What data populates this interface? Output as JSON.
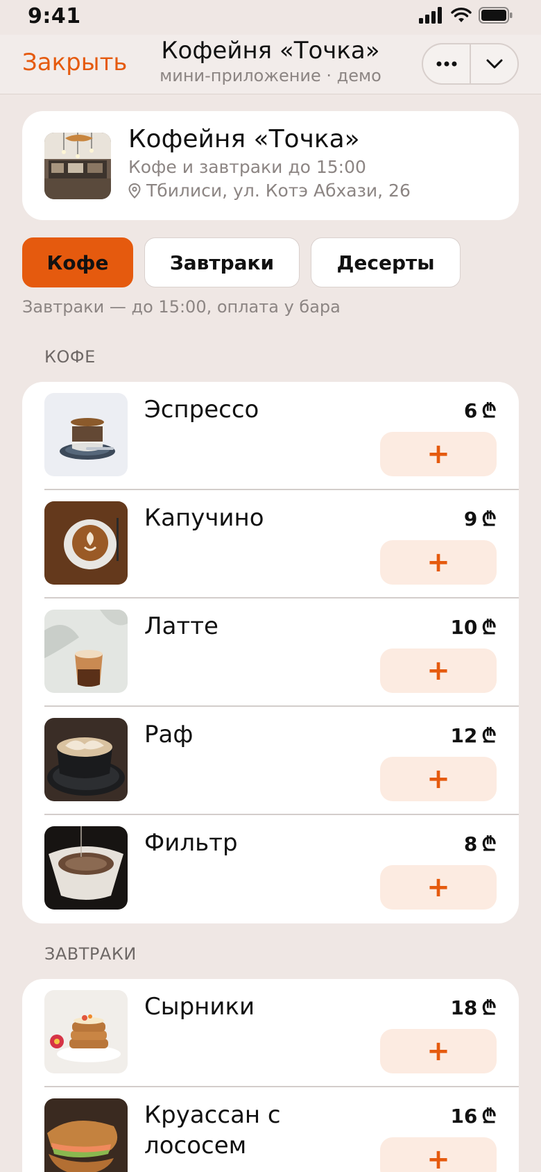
{
  "status_bar": {
    "time": "9:41"
  },
  "header": {
    "close_label": "Закрыть",
    "title": "Кофейня «Точка»",
    "subtitle": "мини-приложение · демо"
  },
  "shop": {
    "name": "Кофейня «Точка»",
    "description": "Кофе и завтраки до 15:00",
    "address": "Тбилиси, ул. Котэ Абхази, 26"
  },
  "tabs": [
    {
      "label": "Кофе",
      "active": true
    },
    {
      "label": "Завтраки",
      "active": false
    },
    {
      "label": "Десерты",
      "active": false
    }
  ],
  "hint": "Завтраки — до 15:00, оплата у бара",
  "currency_symbol": "₾",
  "sections": [
    {
      "title": "КОФЕ",
      "items": [
        {
          "name": "Эспрессо",
          "price": "6"
        },
        {
          "name": "Капучино",
          "price": "9"
        },
        {
          "name": "Латте",
          "price": "10"
        },
        {
          "name": "Раф",
          "price": "12"
        },
        {
          "name": "Фильтр",
          "price": "8"
        }
      ]
    },
    {
      "title": "ЗАВТРАКИ",
      "items": [
        {
          "name": "Сырники",
          "price": "18"
        },
        {
          "name": "Круассан с лососем",
          "price": "16"
        }
      ]
    }
  ],
  "add_label": "+",
  "colors": {
    "accent": "#e55a0e",
    "add_bg": "#fcebe1",
    "background": "#efe7e4"
  }
}
